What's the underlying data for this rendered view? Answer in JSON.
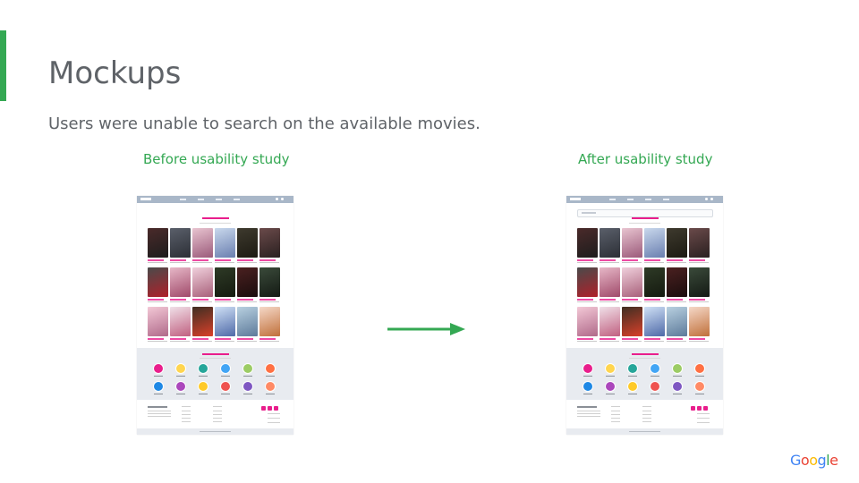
{
  "slide": {
    "title": "Mockups",
    "subtitle": "Users were unable to search on the available movies.",
    "accent_color": "#34a853",
    "text_color": "#5f6368"
  },
  "mockups": {
    "before_label": "Before usability study",
    "after_label": "After usability study",
    "before_has_search_bar": false,
    "after_has_search_bar": true
  },
  "transition": {
    "icon": "arrow-right-icon",
    "color": "#34a853"
  },
  "branding": {
    "logo_letters": [
      "G",
      "o",
      "o",
      "g",
      "l",
      "e"
    ],
    "logo_colors": [
      "#4285f4",
      "#ea4335",
      "#fbbc05",
      "#4285f4",
      "#34a853",
      "#ea4335"
    ]
  }
}
